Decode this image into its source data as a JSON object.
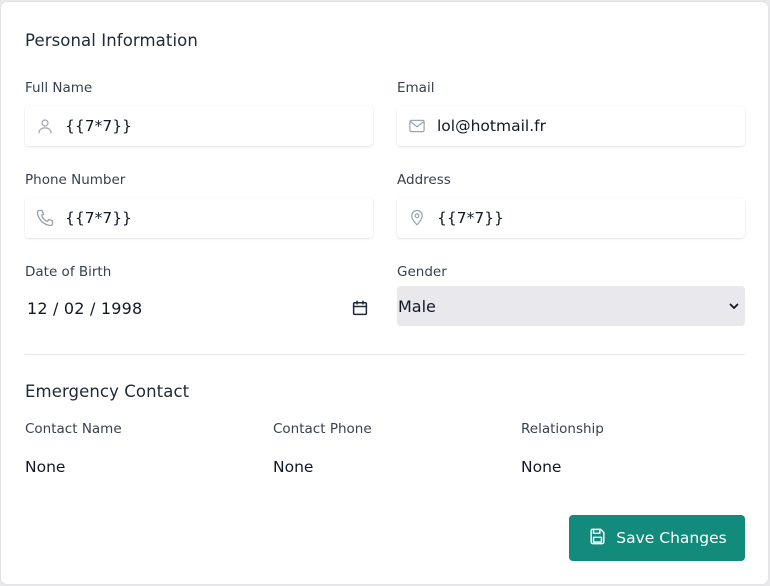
{
  "personal": {
    "title": "Personal Information",
    "full_name": {
      "label": "Full Name",
      "value": "{{7*7}}",
      "icon": "user-icon"
    },
    "email": {
      "label": "Email",
      "value": "lol@hotmail.fr",
      "icon": "mail-icon"
    },
    "phone": {
      "label": "Phone Number",
      "value": "{{7*7}}",
      "icon": "phone-icon"
    },
    "address": {
      "label": "Address",
      "value": "{{7*7}}",
      "icon": "map-pin-icon"
    },
    "dob": {
      "label": "Date of Birth",
      "value": "12 / 02 / 1998",
      "icon": "calendar-icon"
    },
    "gender": {
      "label": "Gender",
      "value": "Male",
      "icon": "chevron-down-icon"
    }
  },
  "emergency": {
    "title": "Emergency Contact",
    "name": {
      "label": "Contact Name",
      "value": "None"
    },
    "phone": {
      "label": "Contact Phone",
      "value": "None"
    },
    "relationship": {
      "label": "Relationship",
      "value": "None"
    }
  },
  "actions": {
    "save_label": "Save Changes",
    "save_icon": "save-icon"
  },
  "colors": {
    "accent": "#138b7c",
    "icon": "#9ca3af",
    "select_bg": "#e8e8ed"
  }
}
